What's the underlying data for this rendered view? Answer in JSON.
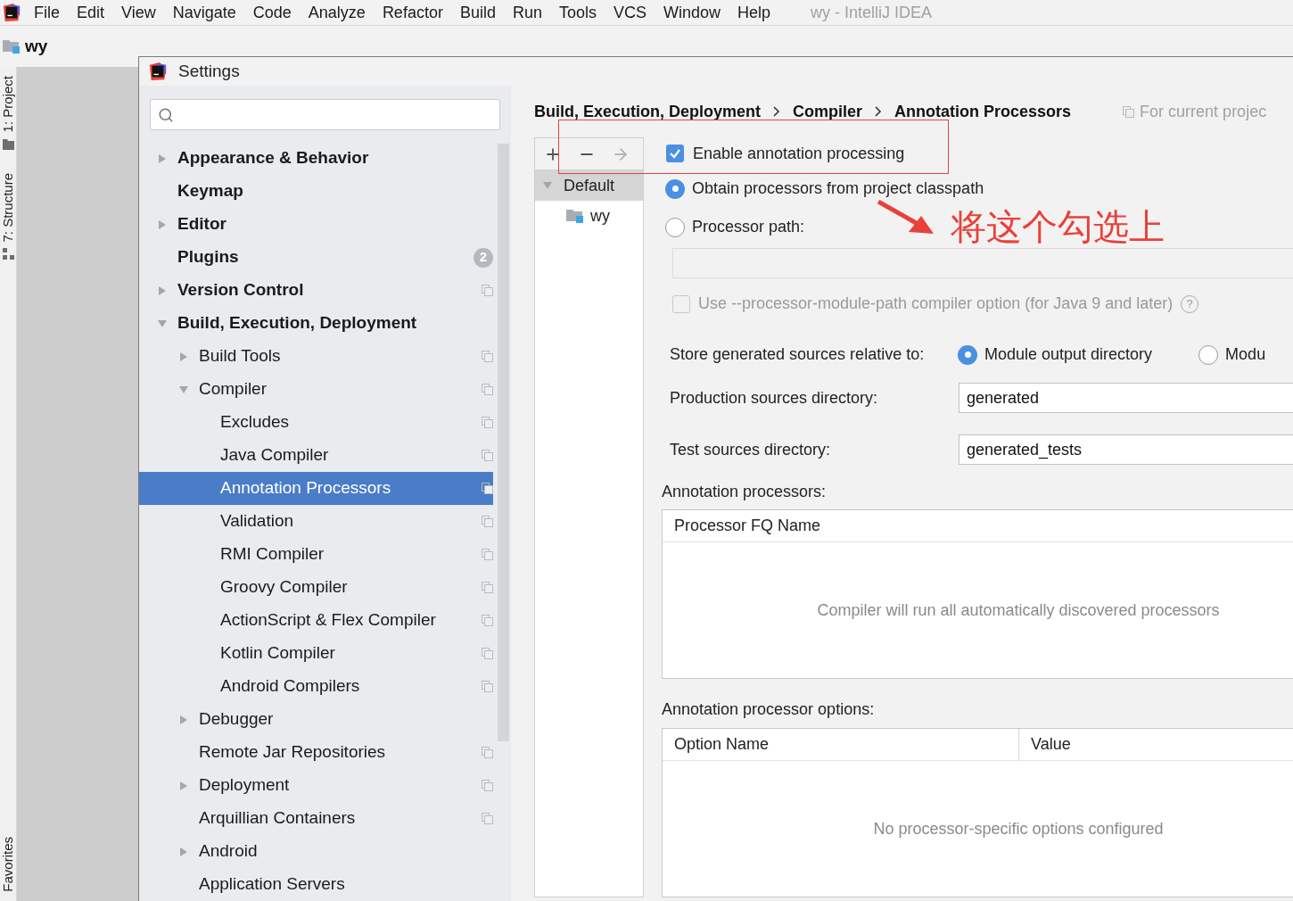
{
  "menu_bar": {
    "items": [
      "File",
      "Edit",
      "View",
      "Navigate",
      "Code",
      "Analyze",
      "Refactor",
      "Build",
      "Run",
      "Tools",
      "VCS",
      "Window",
      "Help"
    ],
    "title": "wy - IntelliJ IDEA"
  },
  "project_bar": {
    "name": "wy"
  },
  "tool_strip": {
    "top_tabs": [
      "1: Project",
      "7: Structure"
    ],
    "bottom_tabs": [
      "Favorites"
    ]
  },
  "dialog": {
    "title": "Settings"
  },
  "sidebar": {
    "items": [
      {
        "label": "Appearance & Behavior",
        "expanded": false,
        "selected": false,
        "project_scope": false
      },
      {
        "label": "Keymap",
        "selected": false,
        "project_scope": false
      },
      {
        "label": "Editor",
        "expanded": false,
        "selected": false,
        "project_scope": false
      },
      {
        "label": "Plugins",
        "selected": false,
        "project_scope": false,
        "badge": "2"
      },
      {
        "label": "Version Control",
        "expanded": false,
        "selected": false,
        "project_scope": true
      },
      {
        "label": "Build, Execution, Deployment",
        "expanded": true,
        "selected": false,
        "project_scope": false,
        "children": [
          {
            "label": "Build Tools",
            "expanded": false,
            "selected": false,
            "project_scope": true
          },
          {
            "label": "Compiler",
            "expanded": true,
            "selected": false,
            "project_scope": true,
            "children": [
              {
                "label": "Excludes",
                "selected": false,
                "project_scope": true
              },
              {
                "label": "Java Compiler",
                "selected": false,
                "project_scope": true
              },
              {
                "label": "Annotation Processors",
                "selected": true,
                "project_scope": true
              },
              {
                "label": "Validation",
                "selected": false,
                "project_scope": true
              },
              {
                "label": "RMI Compiler",
                "selected": false,
                "project_scope": true
              },
              {
                "label": "Groovy Compiler",
                "selected": false,
                "project_scope": true
              },
              {
                "label": "ActionScript & Flex Compiler",
                "selected": false,
                "project_scope": true
              },
              {
                "label": "Kotlin Compiler",
                "selected": false,
                "project_scope": true
              },
              {
                "label": "Android Compilers",
                "selected": false,
                "project_scope": true
              }
            ]
          },
          {
            "label": "Debugger",
            "expanded": false,
            "selected": false,
            "project_scope": false
          },
          {
            "label": "Remote Jar Repositories",
            "selected": false,
            "project_scope": true
          },
          {
            "label": "Deployment",
            "expanded": false,
            "selected": false,
            "project_scope": true
          },
          {
            "label": "Arquillian Containers",
            "selected": false,
            "project_scope": true
          },
          {
            "label": "Android",
            "expanded": false,
            "selected": false,
            "project_scope": false
          },
          {
            "label": "Application Servers",
            "selected": false,
            "project_scope": false
          }
        ]
      }
    ]
  },
  "breadcrumb": {
    "parts": [
      "Build, Execution, Deployment",
      "Compiler",
      "Annotation Processors"
    ],
    "scope_note": "For current projec"
  },
  "profile_toolbar": [
    {
      "kind": "add",
      "disabled": false
    },
    {
      "kind": "remove",
      "disabled": false
    },
    {
      "kind": "move",
      "disabled": true
    }
  ],
  "profiles": [
    {
      "label": "Default",
      "expanded": true,
      "selected": true,
      "children": [
        {
          "label": "wy",
          "selected": false
        }
      ]
    }
  ],
  "enable_processing": {
    "label": "Enable annotation processing",
    "checked": true
  },
  "processor_source": [
    {
      "label": "Obtain processors from project classpath",
      "selected": true
    },
    {
      "label": "Processor path:",
      "selected": false
    }
  ],
  "processor_path": {
    "disabled": true
  },
  "module_path_option": {
    "label": "Use --processor-module-path compiler option (for Java 9 and later)",
    "checked": false,
    "disabled": true,
    "help": "?"
  },
  "store_relative": {
    "label": "Store generated sources relative to:",
    "options": [
      {
        "label": "Module output directory",
        "selected": true
      },
      {
        "label": "Modu",
        "selected": false
      }
    ]
  },
  "production_dir": {
    "label": "Production sources directory:",
    "value": "generated"
  },
  "test_dir": {
    "label": "Test sources directory:",
    "value": "generated_tests"
  },
  "processors_table": {
    "title": "Annotation processors:",
    "columns": [
      "Processor FQ Name"
    ],
    "empty_text": "Compiler will run all automatically discovered processors"
  },
  "options_table": {
    "title": "Annotation processor options:",
    "columns": [
      "Option Name",
      "Value"
    ],
    "empty_text": "No processor-specific options configured"
  },
  "annotation": {
    "text": "将这个勾选上"
  }
}
